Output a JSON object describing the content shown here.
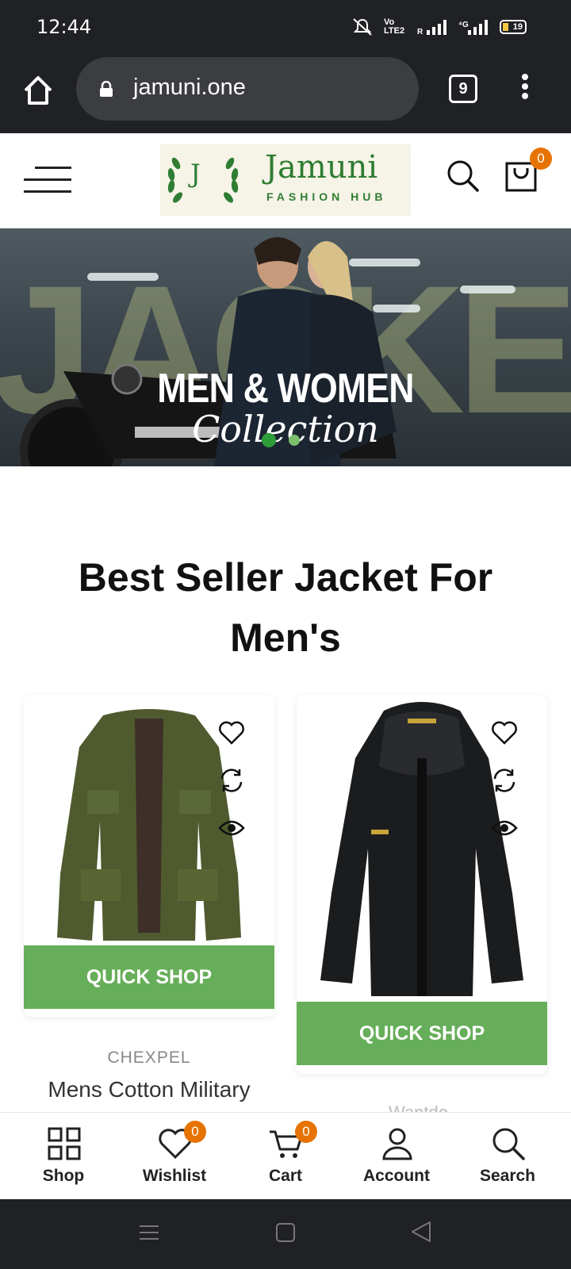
{
  "statusbar": {
    "time": "12:44",
    "net": "Vo LTE2",
    "battery": "19"
  },
  "browser": {
    "url": "jamuni.one",
    "tab_count": "9"
  },
  "header": {
    "logo_letter": "J",
    "logo_name": "Jamuni",
    "logo_tagline": "FASHION HUB",
    "cart_count": "0"
  },
  "hero": {
    "bg_text": "JACKETS",
    "line1": "MEN & WOMEN",
    "line2": "Collection"
  },
  "section": {
    "title": "Best Seller Jacket For Men's"
  },
  "products": [
    {
      "quick_shop": "QUICK SHOP",
      "brand": "CHEXPEL",
      "name": "Mens Cotton Military"
    },
    {
      "quick_shop": "QUICK SHOP",
      "brand": "Wantdo"
    }
  ],
  "bottom_nav": {
    "shop": "Shop",
    "wishlist": "Wishlist",
    "wishlist_count": "0",
    "cart": "Cart",
    "cart_count": "0",
    "account": "Account",
    "search": "Search"
  },
  "colors": {
    "accent_green": "#66ae59",
    "badge_orange": "#e67300",
    "logo_green": "#2e7d32"
  }
}
